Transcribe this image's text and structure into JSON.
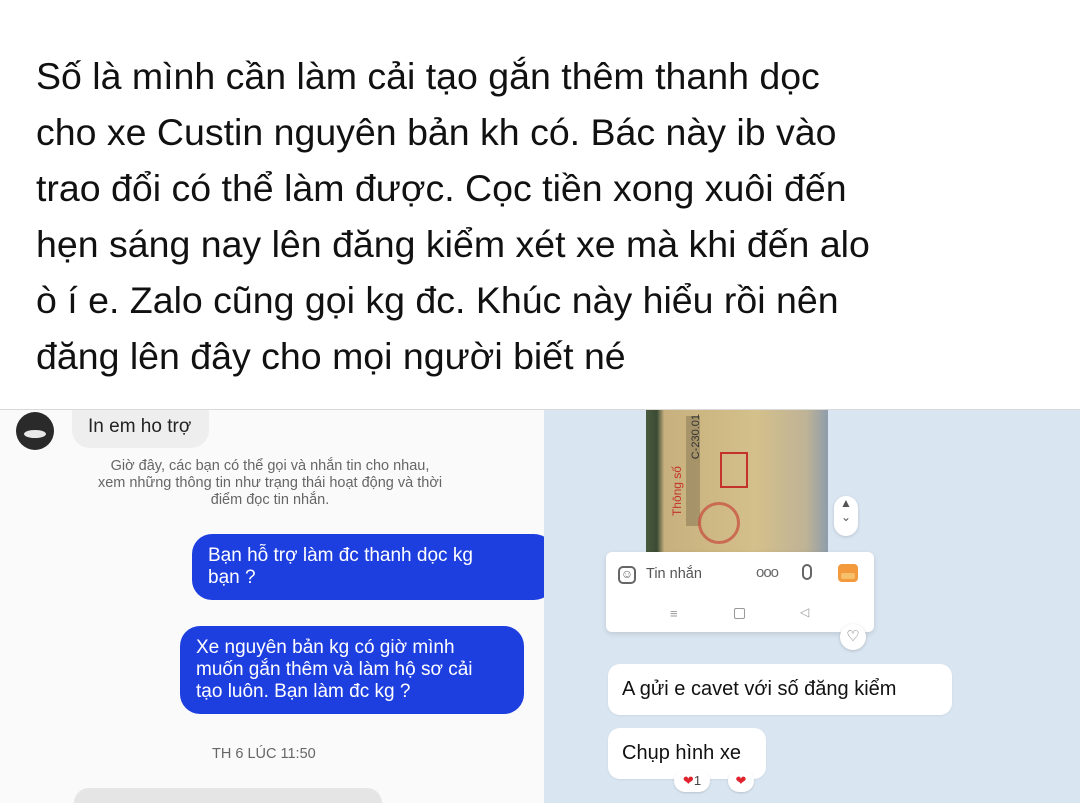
{
  "post": {
    "text": "Số là mình cần làm cải tạo gắn thêm thanh dọc\ncho xe Custin nguyên bản kh có. Bác này ib vào\ntrao đổi có thể làm được. Cọc tiền xong xuôi đến\nhẹn sáng nay lên đăng kiểm xét xe mà khi đến alo\nò í e. Zalo cũng gọi kg đc. Khúc này hiểu rồi nên\nđăng lên đây cho mọi người biết né"
  },
  "messenger": {
    "received_partial": "In em ho trợ",
    "notice": "Giờ đây, các bạn có thể gọi và nhắn tin cho nhau,\nxem những thông tin như trạng thái hoạt động và thời\nđiểm đọc tin nhắn.",
    "sent_messages": [
      "Bạn hỗ trợ làm đc thanh dọc kg\nbạn ?",
      "Xe nguyên bản kg có giờ mình\nmuốn gắn thêm và làm hộ sơ cải\ntạo luôn. Bạn làm đc kg ?"
    ],
    "timestamp": "TH 6 LÚC 11:50",
    "colors": {
      "sent_bubble": "#1e3fe0"
    }
  },
  "zalo": {
    "input_placeholder": "Tin nhắn",
    "more_label": "ooo",
    "messages": [
      "A gửi e cavet với số đăng kiểm",
      "Chụp hình xe"
    ],
    "reaction_count": "1",
    "photo_text_1": "C-230.01",
    "photo_text_2": "Thông số",
    "colors": {
      "background": "#d9e5f1",
      "reaction": "#e0242f"
    }
  }
}
